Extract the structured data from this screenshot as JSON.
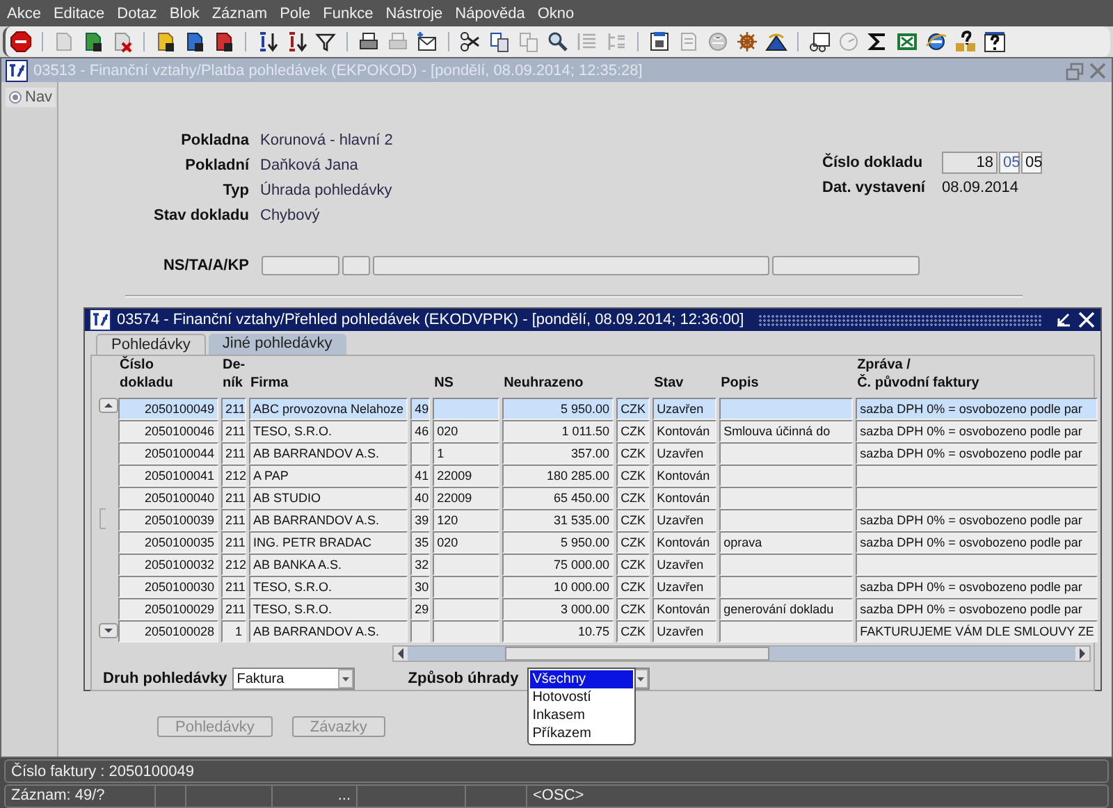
{
  "menu": [
    {
      "label": "Akce"
    },
    {
      "label": "Editace"
    },
    {
      "label": "Dotaz"
    },
    {
      "label": "Blok"
    },
    {
      "label": "Záznam"
    },
    {
      "label": "Pole"
    },
    {
      "label": "Funkce"
    },
    {
      "label": "Nástroje"
    },
    {
      "label": "Nápověda"
    },
    {
      "label": "Okno"
    }
  ],
  "main_window": {
    "title": "03513 - Finanční vztahy/Platba pohledávek (EKPOKOD) - [pondělí, 08.09.2014; 12:35:28]",
    "nav": "Nav",
    "fields": [
      {
        "label": "Pokladna",
        "value": "Korunová - hlavní 2"
      },
      {
        "label": "Pokladní",
        "value": "Daňková Jana"
      },
      {
        "label": "Typ",
        "value": "Úhrada pohledávky"
      },
      {
        "label": "Stav dokladu",
        "value": "Chybový"
      }
    ],
    "cislo_dokladu": {
      "label": "Číslo dokladu",
      "parts": [
        "18",
        "05",
        "05"
      ]
    },
    "dat_vystaveni": {
      "label": "Dat. vystavení",
      "value": "08.09.2014"
    },
    "ns_ta_a_kp": {
      "label": "NS/TA/A/KP"
    },
    "buttons": [
      {
        "label": "Pohledávky",
        "disabled": true
      },
      {
        "label": "Závazky",
        "disabled": true
      }
    ]
  },
  "inner_window": {
    "title": "03574 - Finanční vztahy/Přehled pohledávek (EKODVPPK) - [pondělí, 08.09.2014; 12:36:00]",
    "tabs": [
      {
        "label": "Pohledávky",
        "selected": true
      },
      {
        "label": "Jiné pohledávky",
        "selected": false
      }
    ],
    "columns": [
      {
        "lines": [
          "Číslo",
          "dokladu"
        ]
      },
      {
        "lines": [
          "De-",
          "ník"
        ]
      },
      {
        "lines": [
          "Firma"
        ]
      },
      {},
      {
        "lines": [
          "NS"
        ]
      },
      {
        "lines": [
          "Neuhrazeno"
        ]
      },
      {},
      {
        "lines": [
          "Stav"
        ]
      },
      {
        "lines": [
          "Popis"
        ]
      },
      {
        "lines": [
          "Zpráva /",
          "Č. původní faktury"
        ]
      }
    ],
    "rows": [
      {
        "selected": true,
        "cislo_dokladu": "2050100049",
        "denik": "211",
        "firma": "ABC provozovna Nelahoze",
        "column_4": "49",
        "neuhrazeno": "5 950.00",
        "column_7": "CZK",
        "stav": "Uzavřen",
        "zprava": "sazba DPH 0% = osvobozeno podle par"
      },
      {
        "selected": false,
        "cislo_dokladu": "2050100046",
        "denik": "211",
        "firma": "TESO, S.R.O.",
        "column_4": "46",
        "ns": "020",
        "neuhrazeno": "1 011.50",
        "column_7": "CZK",
        "stav": "Kontován",
        "popis": "Smlouva účinná do",
        "zprava": "sazba DPH 0% = osvobozeno podle par"
      },
      {
        "selected": false,
        "cislo_dokladu": "2050100044",
        "denik": "211",
        "firma": "AB BARRANDOV A.S.",
        "ns": "1",
        "neuhrazeno": "357.00",
        "column_7": "CZK",
        "stav": "Uzavřen",
        "zprava": "sazba DPH 0% = osvobozeno podle par"
      },
      {
        "selected": false,
        "cislo_dokladu": "2050100041",
        "denik": "212",
        "firma": "A PAP",
        "column_4": "41",
        "ns": "22009",
        "neuhrazeno": "180 285.00",
        "column_7": "CZK",
        "stav": "Kontován"
      },
      {
        "selected": false,
        "cislo_dokladu": "2050100040",
        "denik": "211",
        "firma": "AB STUDIO",
        "column_4": "40",
        "ns": "22009",
        "neuhrazeno": "65 450.00",
        "column_7": "CZK",
        "stav": "Kontován"
      },
      {
        "selected": false,
        "cislo_dokladu": "2050100039",
        "denik": "211",
        "firma": "AB BARRANDOV A.S.",
        "column_4": "39",
        "ns": "120",
        "neuhrazeno": "31 535.00",
        "column_7": "CZK",
        "stav": "Uzavřen",
        "zprava": "sazba DPH 0% = osvobozeno podle par"
      },
      {
        "selected": false,
        "cislo_dokladu": "2050100035",
        "denik": "211",
        "firma": "ING. PETR BRADAC",
        "column_4": "35",
        "ns": "020",
        "neuhrazeno": "5 950.00",
        "column_7": "CZK",
        "stav": "Kontován",
        "popis": "oprava",
        "zprava": "sazba DPH 0% = osvobozeno podle par"
      },
      {
        "selected": false,
        "cislo_dokladu": "2050100032",
        "denik": "212",
        "firma": "AB BANKA A.S.",
        "column_4": "32",
        "neuhrazeno": "75 000.00",
        "column_7": "CZK",
        "stav": "Uzavřen"
      },
      {
        "selected": false,
        "cislo_dokladu": "2050100030",
        "denik": "211",
        "firma": "TESO, S.R.O.",
        "column_4": "30",
        "neuhrazeno": "10 000.00",
        "column_7": "CZK",
        "stav": "Uzavřen",
        "zprava": "sazba DPH 0% = osvobozeno podle par"
      },
      {
        "selected": false,
        "cislo_dokladu": "2050100029",
        "denik": "211",
        "firma": "TESO, S.R.O.",
        "column_4": "29",
        "neuhrazeno": "3 000.00",
        "column_7": "CZK",
        "stav": "Kontován",
        "popis": "generování dokladu",
        "zprava": "sazba DPH 0% = osvobozeno podle par"
      },
      {
        "selected": false,
        "cislo_dokladu": "2050100028",
        "denik": "1",
        "firma": "AB BARRANDOV A.S.",
        "neuhrazeno": "10.75",
        "column_7": "CZK",
        "stav": "Uzavřen",
        "zprava": "FAKTURUJEME VÁM DLE SMLOUVY ZE"
      }
    ],
    "druh_pohledavky": {
      "label": "Druh pohledávky",
      "value": "Faktura"
    },
    "zpusob_uhrady": {
      "label": "Způsob úhrady",
      "options": [
        {
          "label": "Všechny",
          "selected": true
        },
        {
          "label": "Hotovostí",
          "selected": false
        },
        {
          "label": "Inkasem",
          "selected": false
        },
        {
          "label": "Příkazem",
          "selected": false
        }
      ]
    }
  },
  "status_bar": {
    "message": "Číslo faktury : 2050100049",
    "segment_1": "Záznam: 49/?",
    "segment_4": "...",
    "segment_7": "<OSC>"
  }
}
